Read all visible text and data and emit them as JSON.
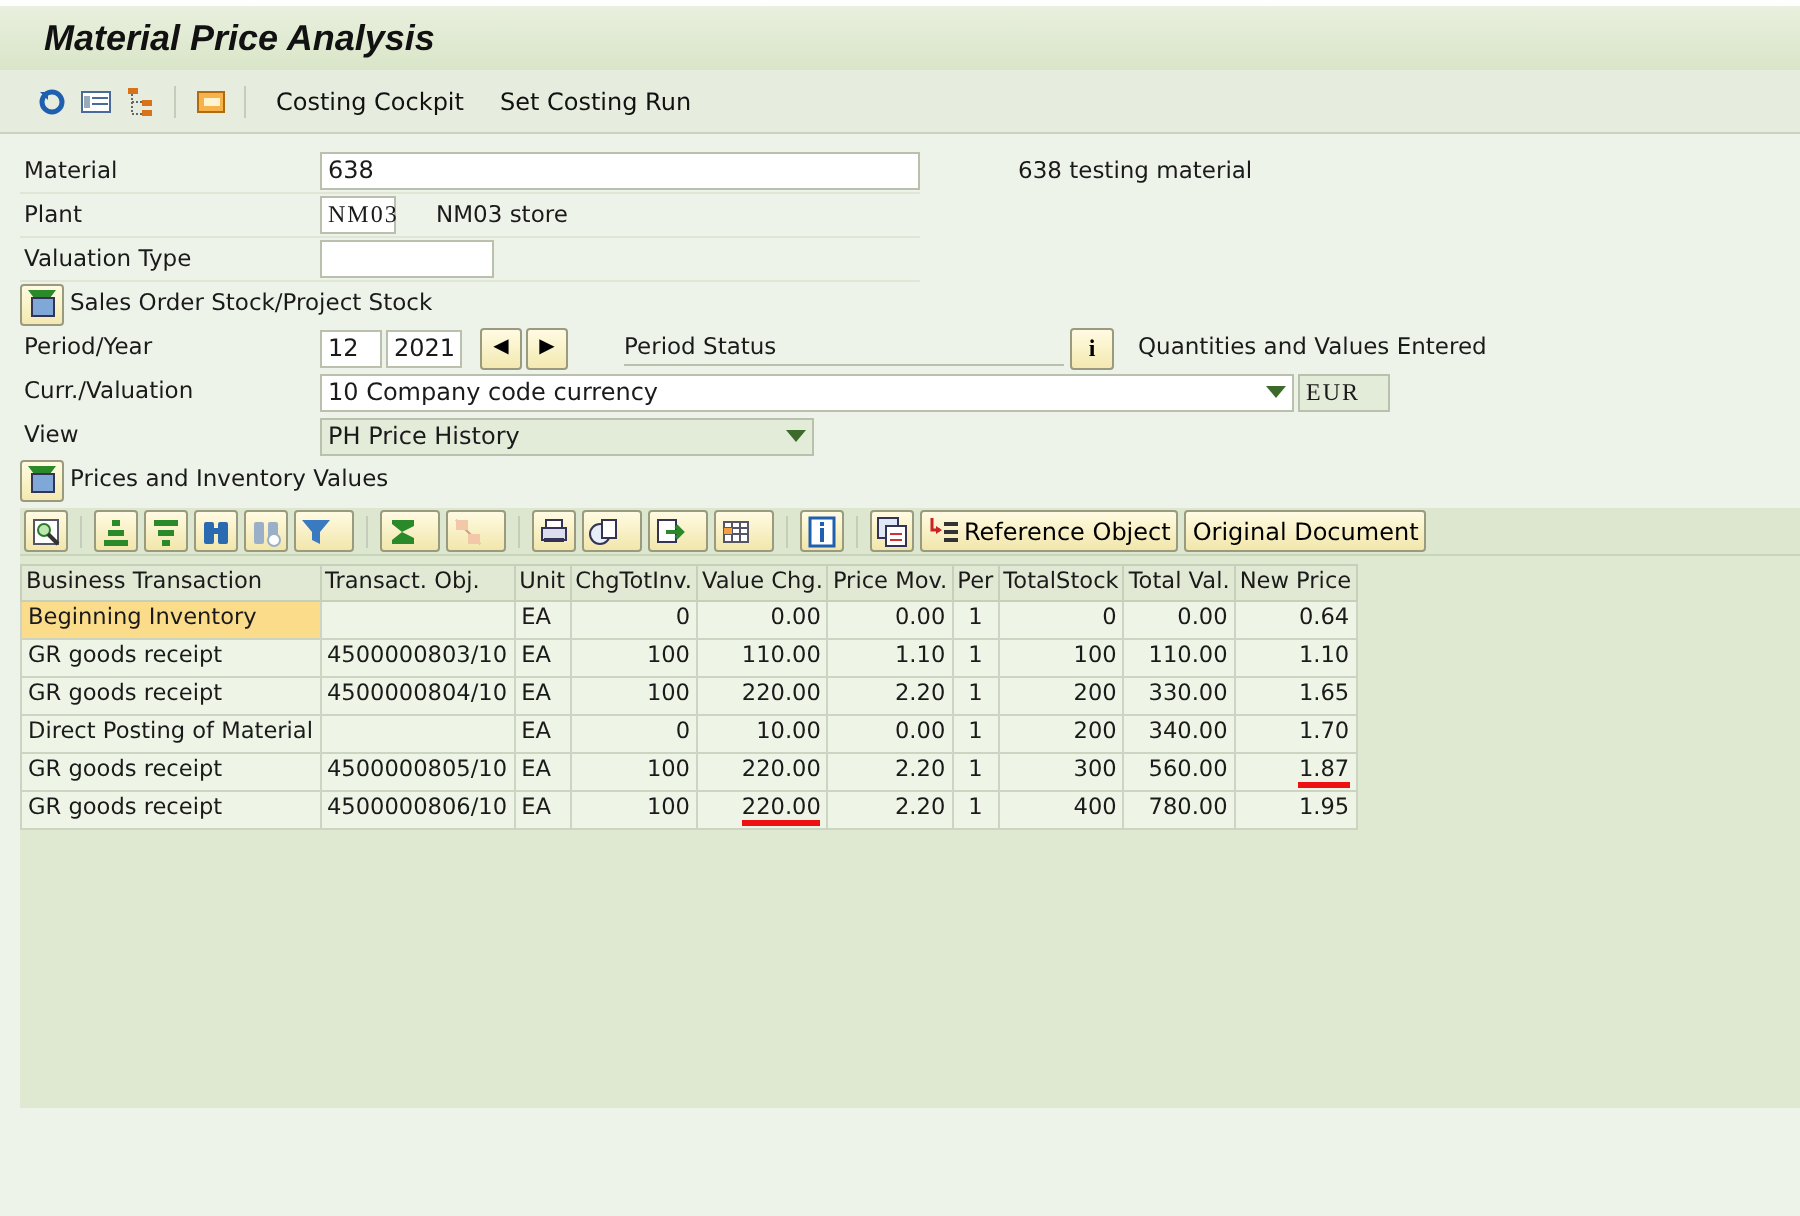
{
  "window": {
    "title": "Material Price Analysis"
  },
  "app_toolbar": {
    "buttons": [
      {
        "label": "Costing Cockpit"
      },
      {
        "label": "Set Costing Run"
      }
    ]
  },
  "form": {
    "material": {
      "label": "Material",
      "value": "638",
      "description": "638 testing material"
    },
    "plant": {
      "label": "Plant",
      "value": "NM03",
      "description": "NM03 store"
    },
    "valuation_type": {
      "label": "Valuation Type"
    },
    "sales_order_stock": {
      "label": "Sales Order Stock/Project Stock"
    },
    "period_year": {
      "label": "Period/Year",
      "period": "12",
      "year": "2021",
      "prev": "◀",
      "next": "▶",
      "status_label": "Period Status",
      "status_button": "i",
      "status": "Quantities and Values Entered"
    },
    "curr_valuation": {
      "label": "Curr./Valuation",
      "value": "10 Company code currency",
      "currency": "EUR"
    },
    "view": {
      "label": "View",
      "value": "PH Price History"
    },
    "prices_section": {
      "label": "Prices and Inventory Values"
    }
  },
  "alv_toolbar": {
    "buttons": [
      {
        "label": "Reference Object"
      },
      {
        "label": "Original Document"
      }
    ]
  },
  "table": {
    "columns": [
      "Business Transaction",
      "Transact. Obj.",
      "Unit",
      "ChgTotInv.",
      "Value Chg.",
      "Price Mov.",
      "Per",
      "TotalStock",
      "Total Val.",
      "New Price"
    ],
    "rows": [
      {
        "selected": true,
        "cells": [
          "Beginning Inventory",
          "",
          "EA",
          "0",
          "0.00",
          "0.00",
          "1",
          "0",
          "0.00",
          "0.64"
        ],
        "red_underlined": [
          false,
          false,
          false,
          false,
          false,
          false,
          false,
          false,
          false,
          false
        ]
      },
      {
        "selected": false,
        "cells": [
          "GR goods receipt",
          "4500000803/10",
          "EA",
          "100",
          "110.00",
          "1.10",
          "1",
          "100",
          "110.00",
          "1.10"
        ],
        "red_underlined": [
          false,
          false,
          false,
          false,
          false,
          false,
          false,
          false,
          false,
          false
        ]
      },
      {
        "selected": false,
        "cells": [
          "GR goods receipt",
          "4500000804/10",
          "EA",
          "100",
          "220.00",
          "2.20",
          "1",
          "200",
          "330.00",
          "1.65"
        ],
        "red_underlined": [
          false,
          false,
          false,
          false,
          false,
          false,
          false,
          false,
          false,
          false
        ]
      },
      {
        "selected": false,
        "cells": [
          "Direct Posting of Material",
          "",
          "EA",
          "0",
          "10.00",
          "0.00",
          "1",
          "200",
          "340.00",
          "1.70"
        ],
        "red_underlined": [
          false,
          false,
          false,
          false,
          false,
          false,
          false,
          false,
          false,
          false
        ]
      },
      {
        "selected": false,
        "cells": [
          "GR goods receipt",
          "4500000805/10",
          "EA",
          "100",
          "220.00",
          "2.20",
          "1",
          "300",
          "560.00",
          "1.87"
        ],
        "red_underlined": [
          false,
          false,
          false,
          false,
          false,
          false,
          false,
          false,
          false,
          true
        ]
      },
      {
        "selected": false,
        "cells": [
          "GR goods receipt",
          "4500000806/10",
          "EA",
          "100",
          "220.00",
          "2.20",
          "1",
          "400",
          "780.00",
          "1.95"
        ],
        "red_underlined": [
          false,
          false,
          false,
          false,
          true,
          false,
          false,
          false,
          false,
          false
        ]
      }
    ]
  }
}
